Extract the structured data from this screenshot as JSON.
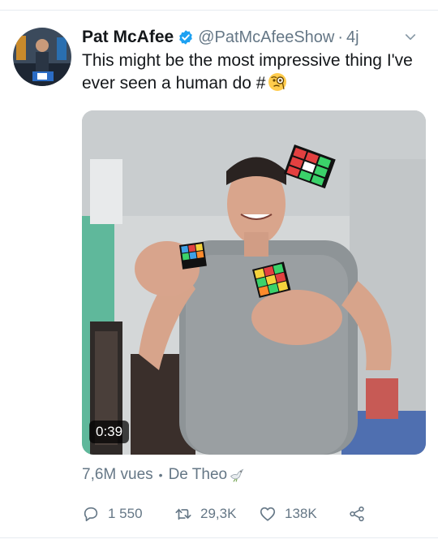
{
  "tweet": {
    "author_name": "Pat McAfee",
    "author_handle": "@PatMcAfeeShow",
    "separator": "·",
    "time": "4j",
    "text": "This might be the most impressive thing I've ever seen a human do #",
    "verified": true
  },
  "media": {
    "duration": "0:39"
  },
  "meta": {
    "views": "7,6M vues",
    "separator": "•",
    "source": "De Theo"
  },
  "actions": {
    "replies": "1 550",
    "retweets": "29,3K",
    "likes": "138K"
  },
  "colors": {
    "text": "#14171a",
    "secondary": "#657786",
    "verified": "#1da1f2",
    "divider": "#e6ecf0"
  },
  "icons": [
    "verified-badge-icon",
    "chevron-down-icon",
    "face-with-monocle-emoji",
    "dove-emoji",
    "reply-icon",
    "retweet-icon",
    "like-icon",
    "share-icon"
  ]
}
